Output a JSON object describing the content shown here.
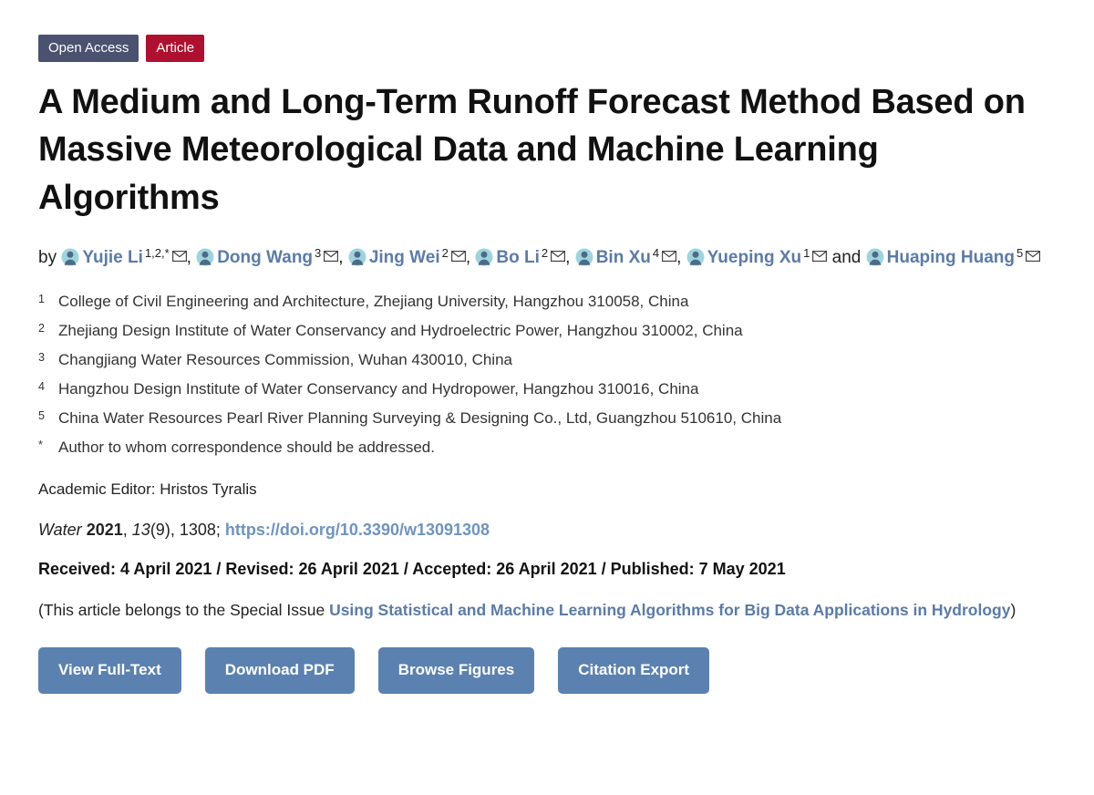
{
  "badges": {
    "open_access": "Open Access",
    "article_type": "Article",
    "open_access_color": "#4a5270",
    "article_type_color": "#b0102f"
  },
  "title": "A Medium and Long-Term Runoff Forecast Method Based on Massive Meteorological Data and Machine Learning Algorithms",
  "byline": {
    "prefix": "by",
    "conjunction": "and",
    "separator": ",",
    "avatar_icon": "author-avatar-icon",
    "email_icon": "envelope-icon",
    "name_color": "#5b7ba8",
    "authors": [
      {
        "name": "Yujie Li",
        "sup": "1,2,*"
      },
      {
        "name": "Dong Wang",
        "sup": "3"
      },
      {
        "name": "Jing Wei",
        "sup": "2"
      },
      {
        "name": "Bo Li",
        "sup": "2"
      },
      {
        "name": "Bin Xu",
        "sup": "4"
      },
      {
        "name": "Yueping Xu",
        "sup": "1"
      },
      {
        "name": "Huaping Huang",
        "sup": "5"
      }
    ]
  },
  "affiliations": [
    {
      "marker": "1",
      "text": "College of Civil Engineering and Architecture, Zhejiang University, Hangzhou 310058, China"
    },
    {
      "marker": "2",
      "text": "Zhejiang Design Institute of Water Conservancy and Hydroelectric Power, Hangzhou 310002, China"
    },
    {
      "marker": "3",
      "text": "Changjiang Water Resources Commission, Wuhan 430010, China"
    },
    {
      "marker": "4",
      "text": "Hangzhou Design Institute of Water Conservancy and Hydropower, Hangzhou 310016, China"
    },
    {
      "marker": "5",
      "text": "China Water Resources Pearl River Planning Surveying & Designing Co., Ltd, Guangzhou 510610, China"
    },
    {
      "marker": "*",
      "text": "Author to whom correspondence should be addressed."
    }
  ],
  "editor": "Academic Editor: Hristos Tyralis",
  "citation": {
    "journal": "Water",
    "year": "2021",
    "volume": "13",
    "issue": "(9)",
    "article_number": "1308",
    "comma": ",",
    "semicolon": ";",
    "doi_text": "https://doi.org/10.3390/w13091308",
    "doi_color": "#6f93c0"
  },
  "dates": "Received: 4 April 2021 / Revised: 26 April 2021 / Accepted: 26 April 2021 / Published: 7 May 2021",
  "special_issue": {
    "prefix": "(This article belongs to the Special Issue ",
    "link": "Using Statistical and Machine Learning Algorithms for Big Data Applications in Hydrology",
    "suffix": ")",
    "link_color": "#5b7ba8"
  },
  "buttons": [
    {
      "label": "View Full-Text"
    },
    {
      "label": "Download PDF"
    },
    {
      "label": "Browse Figures"
    },
    {
      "label": "Citation Export"
    }
  ],
  "button_color": "#5b81b0"
}
